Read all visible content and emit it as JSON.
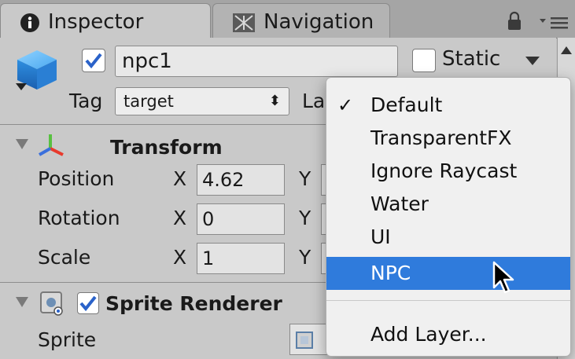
{
  "tabs": [
    {
      "label": "Inspector",
      "icon": "info-icon"
    },
    {
      "label": "Navigation",
      "icon": "navmesh-icon"
    }
  ],
  "header": {
    "active_checked": true,
    "object_name": "npc1",
    "static_label": "Static",
    "static_checked": false,
    "tag_label": "Tag",
    "tag_value": "target",
    "layer_label_partial": "La"
  },
  "transform": {
    "title": "Transform",
    "rows": [
      {
        "label": "Position",
        "x_label": "X",
        "x_value": "4.62",
        "y_label": "Y"
      },
      {
        "label": "Rotation",
        "x_label": "X",
        "x_value": "0",
        "y_label": "Y"
      },
      {
        "label": "Scale",
        "x_label": "X",
        "x_value": "1",
        "y_label": "Y"
      }
    ]
  },
  "sprite_renderer": {
    "title": "Sprite Renderer",
    "enabled": true,
    "sprite_label": "Sprite"
  },
  "layer_menu": {
    "items": [
      "Default",
      "TransparentFX",
      "Ignore Raycast",
      "Water",
      "UI",
      "NPC"
    ],
    "checked_item": "Default",
    "highlighted_item": "NPC",
    "add_layer": "Add Layer..."
  },
  "colors": {
    "highlight": "#2f7bdc",
    "checkbox_blue": "#2a62c9",
    "panel_bg": "#c9c9c9"
  }
}
